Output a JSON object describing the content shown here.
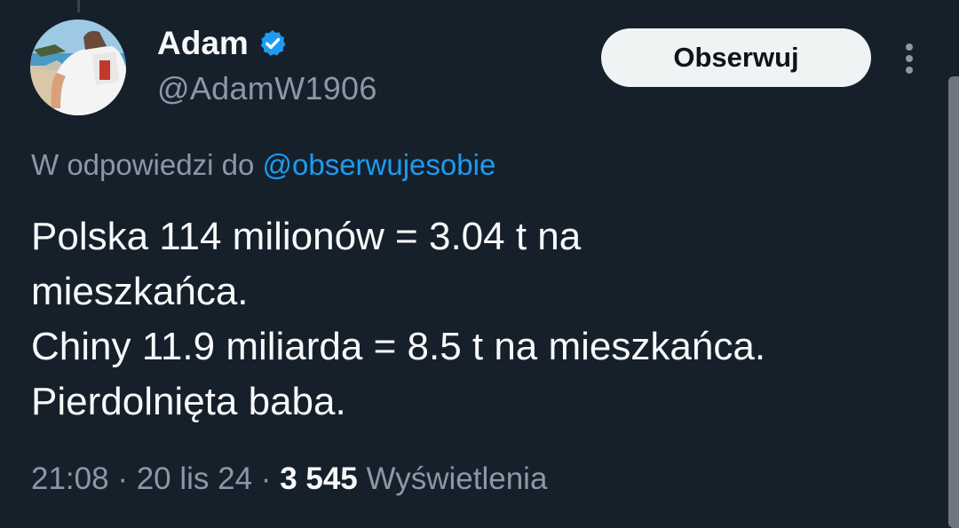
{
  "author": {
    "name": "Adam",
    "handle": "@AdamW1906",
    "verified": true
  },
  "actions": {
    "follow_label": "Obserwuj",
    "more_icon": "more-vertical-icon"
  },
  "reply": {
    "prefix": "W odpowiedzi do ",
    "mention": "@obserwujesobie"
  },
  "tweet": {
    "lines": [
      "Polska 114 milionów = 3.04 t na",
      "mieszkańca.",
      "Chiny 11.9 miliarda = 8.5 t na mieszkańca.",
      "Pierdolnięta baba."
    ]
  },
  "meta": {
    "time": "21:08",
    "separator": " · ",
    "date": "20 lis 24",
    "views_count": "3 545",
    "views_label": " Wyświetlenia"
  },
  "colors": {
    "background": "#15202b",
    "text": "#f7f9f9",
    "muted": "#8b98a5",
    "accent": "#1d9bf0",
    "button_bg": "#eff3f4"
  }
}
